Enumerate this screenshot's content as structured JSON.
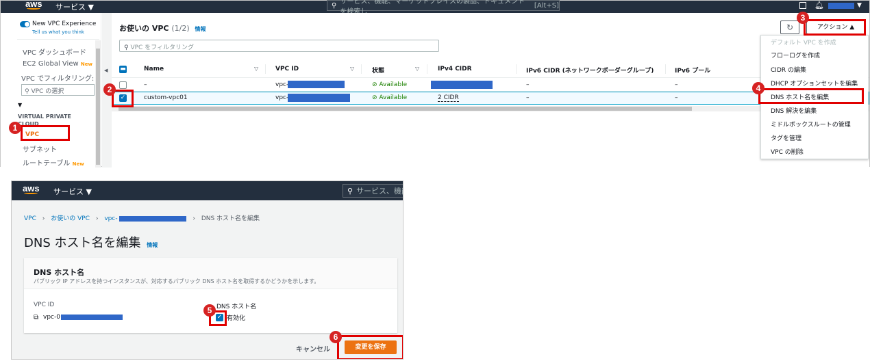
{
  "shot1": {
    "nav": {
      "logo": "aws",
      "services": "サービス ▼",
      "search_placeholder": "サービス、機能、マーケットプレイスの製品、ドキュメントを検索し",
      "search_shortcut": "[Alt+S]"
    },
    "sidebar": {
      "toggle_label": "New VPC Experience",
      "tell_us": "Tell us what you think",
      "items": [
        {
          "label": "VPC ダッシュボード"
        },
        {
          "label": "EC2 Global View",
          "badge": "New"
        },
        {
          "label": "VPC でフィルタリング:"
        }
      ],
      "filter_placeholder": "VPC の選択",
      "section_arrow": "▼",
      "section_title": "VIRTUAL PRIVATE CLOUD",
      "vpc_item": "VPC",
      "subnet_item": "サブネット",
      "route_item": "ルートテーブル",
      "route_badge": "New"
    },
    "main": {
      "title": "お使いの VPC",
      "count": "(1/2)",
      "info": "情報",
      "refresh": "↻",
      "actions_label": "アクション ▲",
      "filter_placeholder": "VPC をフィルタリング",
      "collapse_arrow": "◀",
      "columns": [
        "Name",
        "VPC ID",
        "状態",
        "IPv4 CIDR",
        "IPv6 CIDR (ネットワークボーダーグループ)",
        "IPv6 プール"
      ],
      "rows": [
        {
          "name": "–",
          "vpc_id": "vpc-",
          "state": "Available",
          "ipv4": "",
          "ipv6": "–",
          "pool": "–",
          "selected": false
        },
        {
          "name": "custom-vpc01",
          "vpc_id": "vpc-",
          "state": "Available",
          "ipv4": "2 CIDR",
          "ipv6": "–",
          "pool": "–",
          "selected": true
        }
      ]
    },
    "actions_menu": [
      "デフォルト VPC を作成",
      "フローログを作成",
      "CIDR の編集",
      "DHCP オプションセットを編集",
      "DNS ホスト名を編集",
      "DNS 解決を編集",
      "ミドルボックスルートの管理",
      "タグを管理",
      "VPC の削除"
    ]
  },
  "shot2": {
    "nav": {
      "logo": "aws",
      "services": "サービス ▼",
      "search_placeholder": "サービス、機能"
    },
    "breadcrumb": [
      "VPC",
      "お使いの VPC",
      "vpc-",
      "DNS ホスト名を編集"
    ],
    "page_title": "DNS ホスト名を編集",
    "info": "情報",
    "panel_title": "DNS ホスト名",
    "panel_desc": "パブリック IP アドレスを持つインスタンスが、対応するパブリック DNS ホスト名を取得するかどうかを示します。",
    "vpc_id_label": "VPC ID",
    "vpc_id_value": "vpc-0",
    "dns_label": "DNS ホスト名",
    "enable_label": "有効化",
    "cancel": "キャンセル",
    "save": "変更を保存"
  },
  "callouts": [
    "1",
    "2",
    "3",
    "4",
    "5",
    "6"
  ],
  "colors": {
    "accent": "#ff9900",
    "nav": "#232f3e",
    "link": "#0073bb",
    "callout": "#d62222",
    "redact": "#2f67c8"
  }
}
